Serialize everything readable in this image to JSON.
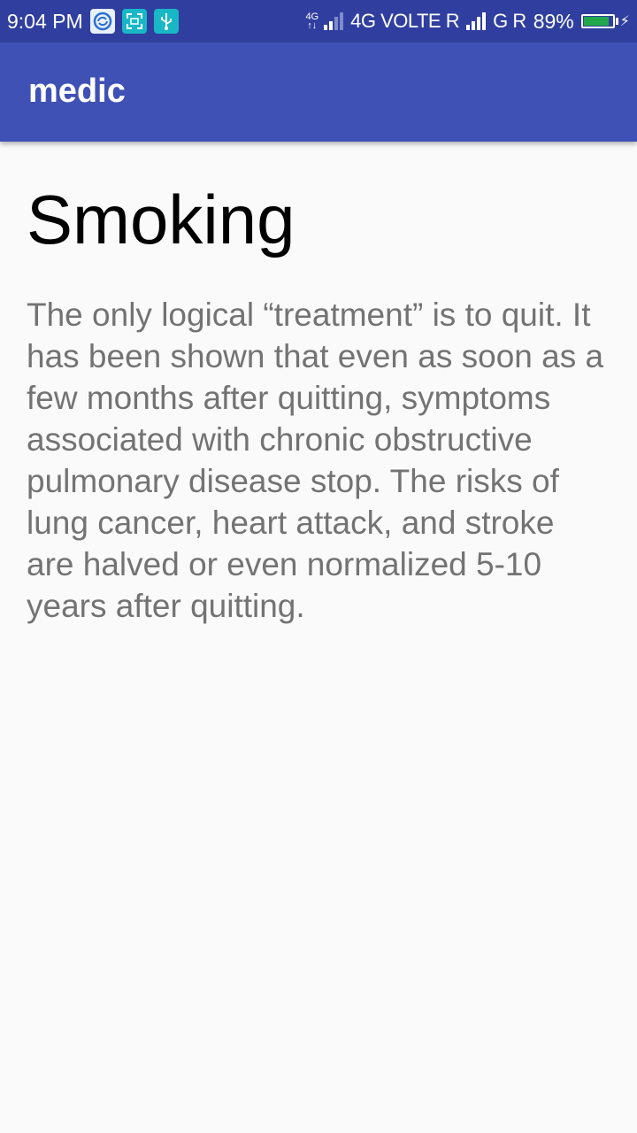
{
  "status_bar": {
    "time": "9:04 PM",
    "notification_icons": [
      "sync-icon",
      "screenshot-icon",
      "usb-icon"
    ],
    "net_small_top": "4G",
    "net_small_bottom": "↑↓",
    "sim1_label": "4G VOLTE R",
    "sim2_label": "G R",
    "battery_percent": "89%",
    "battery_level": 0.89,
    "battery_color": "#22a84a"
  },
  "app_bar": {
    "title": "medic",
    "color": "#3f51b5"
  },
  "article": {
    "title": "Smoking",
    "body": "The only logical “treatment” is to quit. It has been shown that even as soon as a few months after quitting, symptoms associated with chronic obstructive pulmonary disease stop. The risks of lung cancer, heart attack, and stroke are halved or even normalized 5-10 years after quitting."
  }
}
